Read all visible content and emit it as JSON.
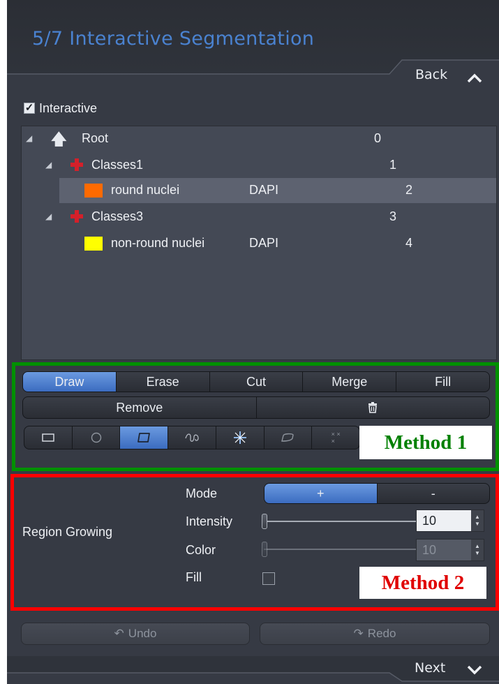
{
  "header": {
    "title": "5/7  Interactive Segmentation"
  },
  "nav": {
    "back_label": "Back",
    "next_label": "Next"
  },
  "interactive": {
    "label": "Interactive",
    "checked": true
  },
  "tree": {
    "rows": [
      {
        "name": "Root",
        "channel": "",
        "id": "0"
      },
      {
        "name": "Classes1",
        "channel": "",
        "id": "1"
      },
      {
        "name": "round nuclei",
        "channel": "DAPI",
        "id": "2",
        "color": "#ff6a00"
      },
      {
        "name": "Classes3",
        "channel": "",
        "id": "3"
      },
      {
        "name": "non-round nuclei",
        "channel": "DAPI",
        "id": "4",
        "color": "#ffff00"
      }
    ]
  },
  "draw_tools": {
    "tabs": [
      "Draw",
      "Erase",
      "Cut",
      "Merge",
      "Fill"
    ],
    "active_tab": "Draw",
    "remove_label": "Remove",
    "icons": [
      "rectangle-tool-icon",
      "circle-tool-icon",
      "rounded-polygon-tool-icon",
      "spline-tool-icon",
      "magic-wand-tool-icon",
      "freehand-tool-icon",
      "points-tool-icon"
    ],
    "active_icon": "rounded-polygon-tool-icon"
  },
  "annotations": {
    "method1": "Method 1",
    "method2": "Method 2",
    "method1_color": "#008000",
    "method2_color": "#e00000"
  },
  "region_growing": {
    "title": "Region Growing",
    "mode_label": "Mode",
    "mode_options": [
      "+",
      "-"
    ],
    "mode_active": "+",
    "intensity_label": "Intensity",
    "intensity_value": "10",
    "color_label": "Color",
    "color_value": "10",
    "fill_label": "Fill",
    "fill_checked": false
  },
  "actions": {
    "undo_label": "Undo",
    "redo_label": "Redo"
  },
  "colors": {
    "accent": "#4a82d0",
    "panel": "#363a44"
  }
}
